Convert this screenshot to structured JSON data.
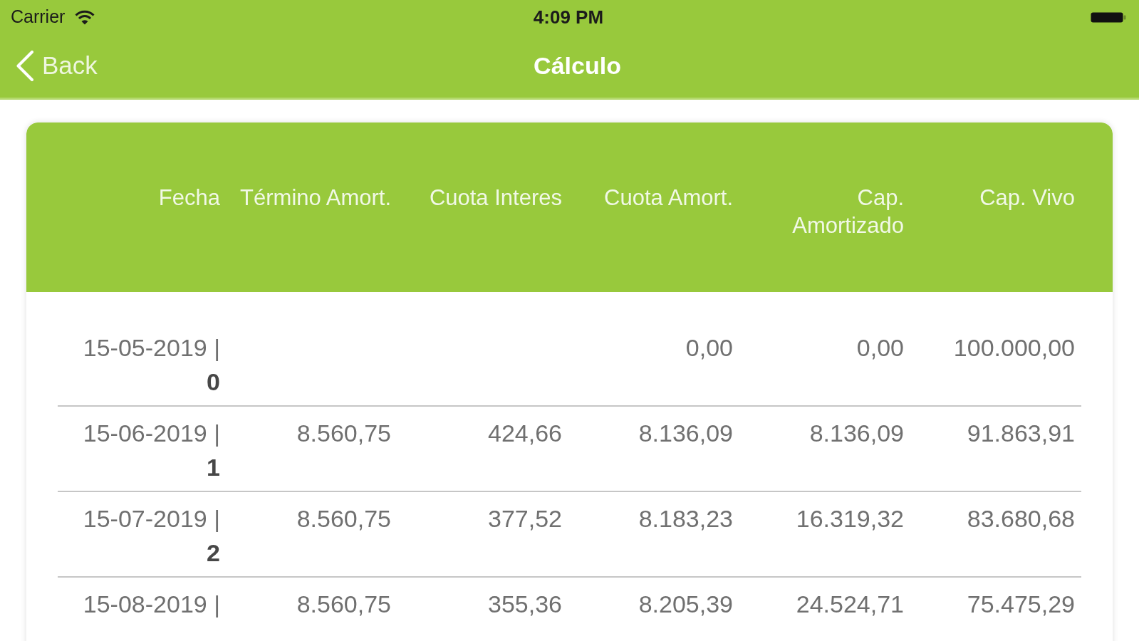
{
  "status_bar": {
    "carrier": "Carrier",
    "time": "4:09 PM"
  },
  "nav_bar": {
    "back": "Back",
    "title": "Cálculo"
  },
  "table": {
    "columns": [
      "Fecha",
      "Término Amort.",
      "Cuota Interes",
      "Cuota Amort.",
      "Cap. Amortizado",
      "Cap. Vivo"
    ],
    "rows": [
      {
        "date": "15-05-2019 |",
        "number": "0",
        "cuota_amort": "0,00",
        "cap_amortizado": "0,00",
        "cap_vivo": "100.000,00"
      },
      {
        "date": "15-06-2019 |",
        "number": "1",
        "termino_amort": "8.560,75",
        "cuota_interes": "424,66",
        "cuota_amort": "8.136,09",
        "cap_amortizado": "8.136,09",
        "cap_vivo": "91.863,91"
      },
      {
        "date": "15-07-2019 |",
        "number": "2",
        "termino_amort": "8.560,75",
        "cuota_interes": "377,52",
        "cuota_amort": "8.183,23",
        "cap_amortizado": "16.319,32",
        "cap_vivo": "83.680,68"
      },
      {
        "date": "15-08-2019 |",
        "termino_amort": "8.560,75",
        "cuota_interes": "355,36",
        "cuota_amort": "8.205,39",
        "cap_amortizado": "24.524,71",
        "cap_vivo": "75.475,29"
      }
    ]
  }
}
